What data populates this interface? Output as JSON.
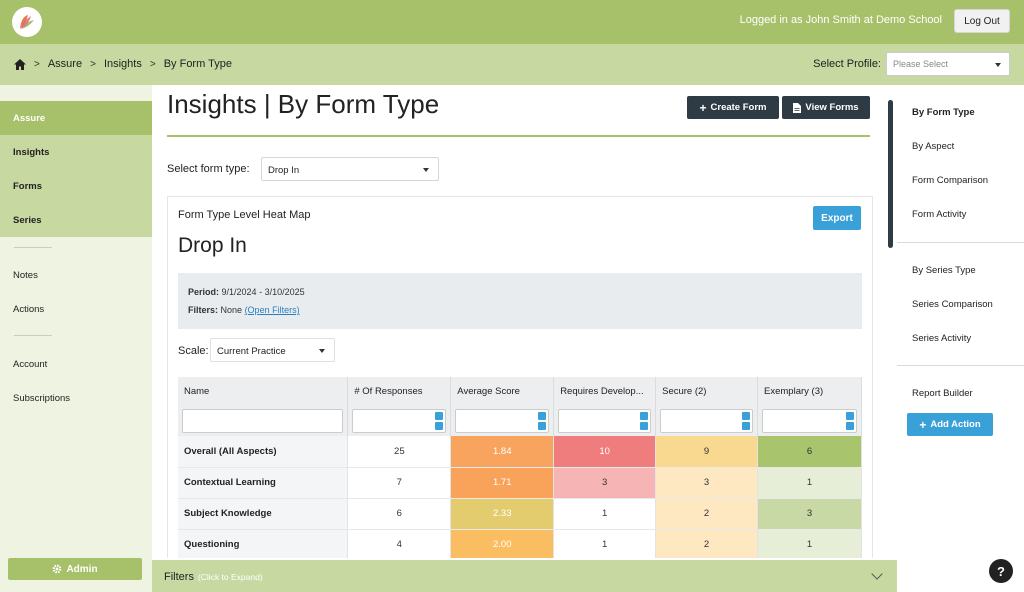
{
  "topbar": {
    "logged_in": "Logged in as John Smith at Demo School",
    "logout": "Log Out"
  },
  "breadcrumb": {
    "items": [
      "Assure",
      "Insights",
      "By Form Type"
    ],
    "profile_label": "Select Profile:",
    "profile_placeholder": "Please Select"
  },
  "left_nav": {
    "items": [
      "Assure",
      "Insights",
      "Forms",
      "Series",
      "Notes",
      "Actions",
      "Account",
      "Subscriptions"
    ],
    "admin": "Admin"
  },
  "main": {
    "title": "Insights | By Form Type",
    "create_form": "Create Form",
    "view_forms": "View Forms",
    "form_type_label": "Select form type:",
    "form_type_value": "Drop In",
    "panel_heading": "Form Type Level Heat Map",
    "export": "Export",
    "panel_title": "Drop In",
    "period_label": "Period:",
    "period_value": "9/1/2024 - 3/10/2025",
    "filters_label": "Filters:",
    "filters_value": "None",
    "open_filters": "(Open Filters)",
    "scale_label": "Scale:",
    "scale_value": "Current Practice"
  },
  "table": {
    "headers": [
      "Name",
      "# Of Responses",
      "Average Score",
      "Requires Develop...",
      "Secure (2)",
      "Exemplary (3)"
    ],
    "rows": [
      {
        "name": "Overall (All Aspects)",
        "responses": "25",
        "avg": "1.84",
        "req": "10",
        "secure": "9",
        "exemplary": "6"
      },
      {
        "name": "Contextual Learning",
        "responses": "7",
        "avg": "1.71",
        "req": "3",
        "secure": "3",
        "exemplary": "1"
      },
      {
        "name": "Subject Knowledge",
        "responses": "6",
        "avg": "2.33",
        "req": "1",
        "secure": "2",
        "exemplary": "3"
      },
      {
        "name": "Questioning",
        "responses": "4",
        "avg": "2.00",
        "req": "1",
        "secure": "2",
        "exemplary": "1"
      }
    ],
    "colors": {
      "avg": [
        "#f9a45e",
        "#f9a25a",
        "#e3cc6e",
        "#fbbd62"
      ],
      "req": [
        "#f07d7d",
        "#f7b4b4",
        "#ffffff",
        "#ffffff"
      ],
      "secure": [
        "#f9d98f",
        "#fde8c2",
        "#fde8c2",
        "#fde8c2"
      ],
      "exemplary": [
        "#a8c46c",
        "#e6eed7",
        "#c9d9a5",
        "#e6eed7"
      ]
    }
  },
  "filters_bar": {
    "title": "Filters",
    "hint": "(Click to Expand)"
  },
  "right_nav": {
    "items": [
      "By Form Type",
      "By Aspect",
      "Form Comparison",
      "Form Activity",
      "By Series Type",
      "Series Comparison",
      "Series Activity",
      "Report Builder"
    ],
    "add_action": "Add Action"
  },
  "help": "?"
}
